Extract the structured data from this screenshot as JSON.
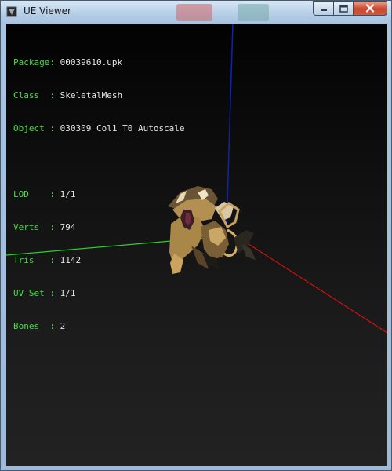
{
  "window": {
    "title": "UE Viewer"
  },
  "info_block_1": [
    {
      "key": "Package",
      "sep": ": ",
      "value": "00039610.upk"
    },
    {
      "key": "Class  ",
      "sep": ": ",
      "value": "SkeletalMesh"
    },
    {
      "key": "Object ",
      "sep": ": ",
      "value": "030309_Col1_T0_Autoscale"
    }
  ],
  "info_block_2": [
    {
      "key": "LOD    ",
      "sep": ": ",
      "value": "1/1"
    },
    {
      "key": "Verts  ",
      "sep": ": ",
      "value": "794"
    },
    {
      "key": "Tris   ",
      "sep": ": ",
      "value": "1142"
    },
    {
      "key": "UV Set ",
      "sep": ": ",
      "value": "1/1"
    },
    {
      "key": "Bones  ",
      "sep": ": ",
      "value": "2"
    }
  ],
  "colors": {
    "label": "#3ee03e",
    "value": "#e6e6e6",
    "axis_x": "#d01010",
    "axis_y": "#28d028",
    "axis_z": "#1020c0"
  }
}
